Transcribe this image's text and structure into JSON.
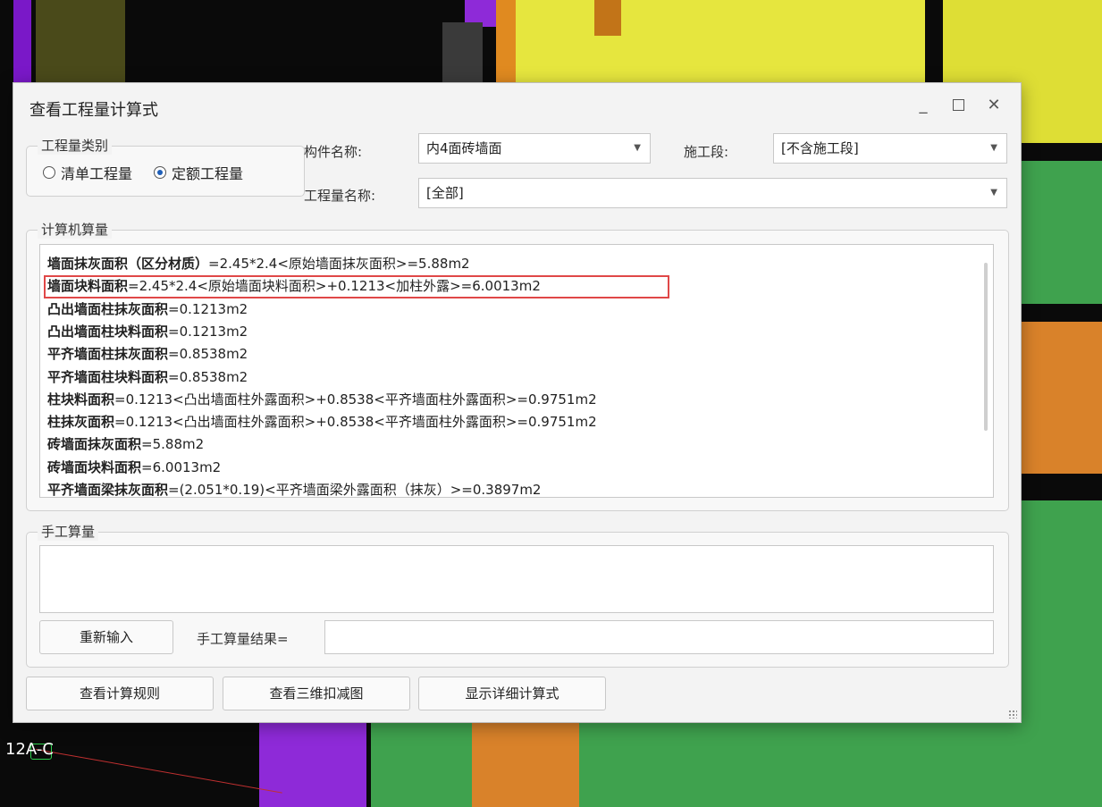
{
  "viewport": {
    "axis_label": "12A-C"
  },
  "dialog": {
    "title": "查看工程量计算式",
    "window_controls": {
      "minimize_icon": "minimize-icon",
      "maximize_icon": "maximize-icon",
      "close_icon": "close-icon"
    },
    "quantity_type": {
      "legend": "工程量类别",
      "options": [
        "清单工程量",
        "定额工程量"
      ],
      "selected": "定额工程量"
    },
    "component": {
      "label": "构件名称:",
      "value": "内4面砖墙面"
    },
    "stage": {
      "label": "施工段:",
      "value": "[不含施工段]"
    },
    "quantity_name": {
      "label": "工程量名称:",
      "value": "[全部]"
    },
    "computer": {
      "legend": "计算机算量",
      "lines": [
        {
          "name": "墙面抹灰面积（区分材质）",
          "formula": "=2.45*2.4<原始墙面抹灰面积>=5.88m2"
        },
        {
          "name": "墙面块料面积",
          "formula": "=2.45*2.4<原始墙面块料面积>+0.1213<加柱外露>=6.0013m2"
        },
        {
          "name": "凸出墙面柱抹灰面积",
          "formula": "=0.1213m2"
        },
        {
          "name": "凸出墙面柱块料面积",
          "formula": "=0.1213m2"
        },
        {
          "name": "平齐墙面柱抹灰面积",
          "formula": "=0.8538m2"
        },
        {
          "name": "平齐墙面柱块料面积",
          "formula": "=0.8538m2"
        },
        {
          "name": "柱块料面积",
          "formula": "=0.1213<凸出墙面柱外露面积>+0.8538<平齐墙面柱外露面积>=0.9751m2"
        },
        {
          "name": "柱抹灰面积",
          "formula": "=0.1213<凸出墙面柱外露面积>+0.8538<平齐墙面柱外露面积>=0.9751m2"
        },
        {
          "name": "砖墙面抹灰面积",
          "formula": "=5.88m2"
        },
        {
          "name": "砖墙面块料面积",
          "formula": "=6.0013m2"
        },
        {
          "name": "平齐墙面梁抹灰面积",
          "formula": "=(2.051*0.19)<平齐墙面梁外露面积（抹灰）>=0.3897m2"
        }
      ],
      "highlight_color": "#e04848"
    },
    "manual": {
      "legend": "手工算量",
      "reinput_label": "重新输入",
      "result_label": "手工算量结果="
    },
    "buttons": {
      "rules": "查看计算规则",
      "view3d": "查看三维扣减图",
      "detail": "显示详细计算式"
    }
  }
}
